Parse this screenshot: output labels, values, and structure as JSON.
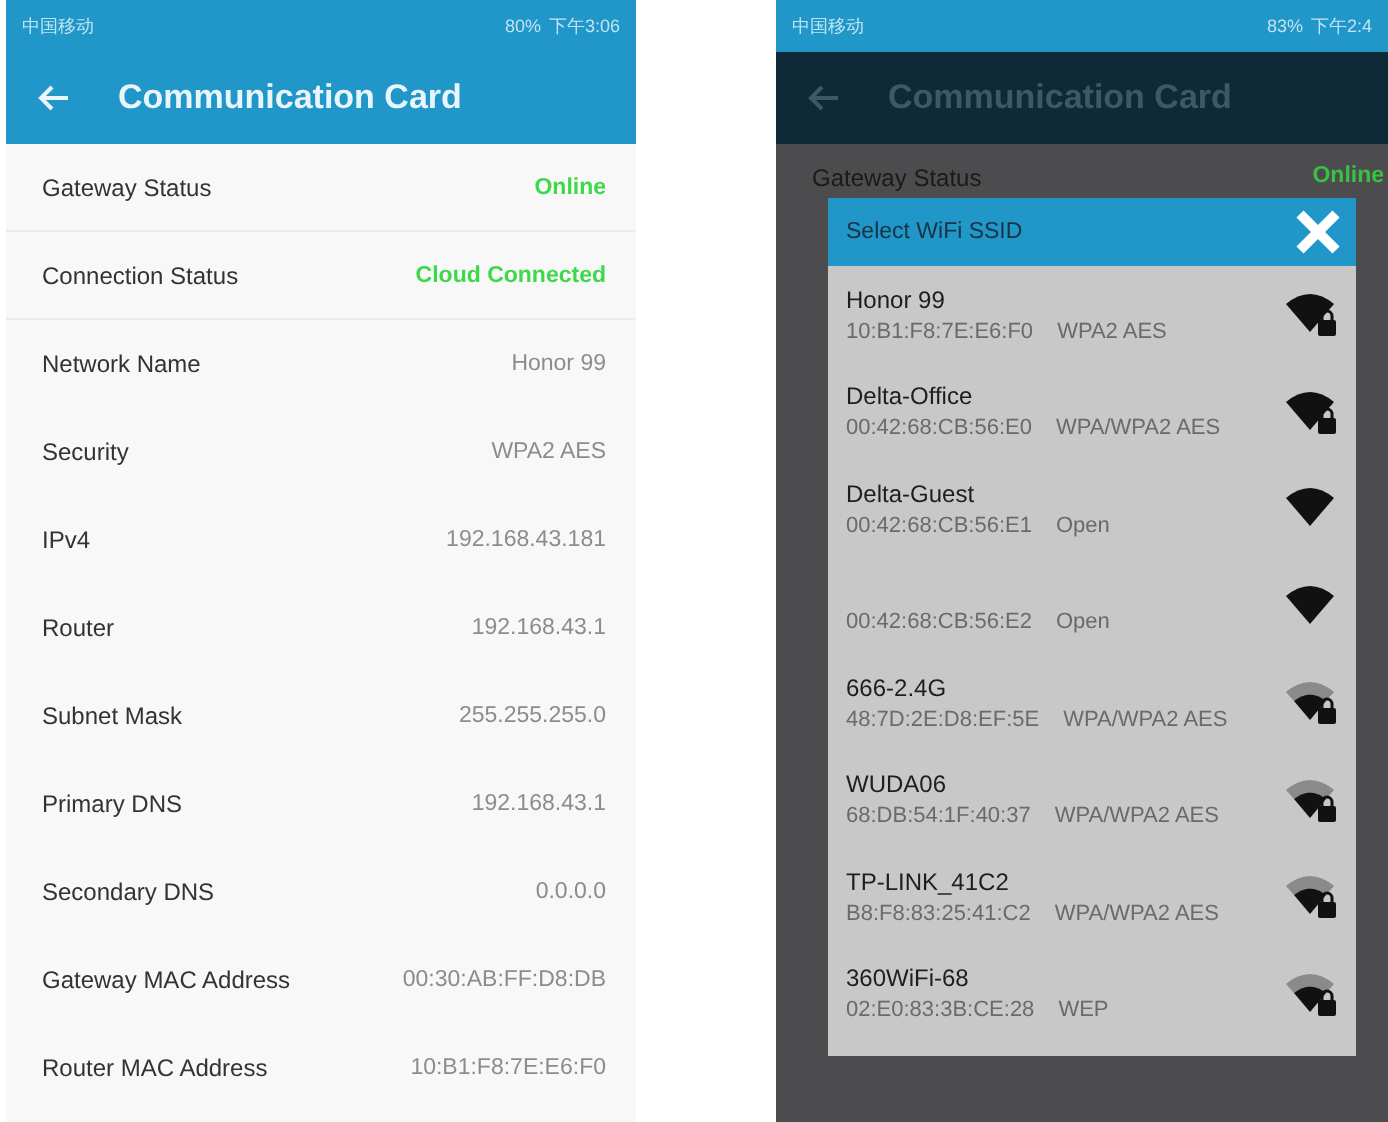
{
  "left_phone": {
    "status_bar": {
      "carrier": "中国移动",
      "battery": "80%",
      "time": "下午3:06"
    },
    "title_bar": {
      "title": "Communication Card"
    },
    "rows": [
      {
        "label": "Gateway Status",
        "value": "Online",
        "kind": "status"
      },
      {
        "label": "Connection Status",
        "value": "Cloud Connected",
        "kind": "status"
      },
      {
        "label": "Network Name",
        "value": "Honor 99",
        "kind": "plain"
      },
      {
        "label": "Security",
        "value": "WPA2 AES",
        "kind": "plain"
      },
      {
        "label": "IPv4",
        "value": "192.168.43.181",
        "kind": "plain"
      },
      {
        "label": "Router",
        "value": "192.168.43.1",
        "kind": "plain"
      },
      {
        "label": "Subnet Mask",
        "value": "255.255.255.0",
        "kind": "plain"
      },
      {
        "label": "Primary DNS",
        "value": "192.168.43.1",
        "kind": "plain"
      },
      {
        "label": "Secondary DNS",
        "value": "0.0.0.0",
        "kind": "plain"
      },
      {
        "label": "Gateway MAC Address",
        "value": "00:30:AB:FF:D8:DB",
        "kind": "plain"
      },
      {
        "label": "Router MAC Address",
        "value": "10:B1:F8:7E:E6:F0",
        "kind": "plain"
      }
    ]
  },
  "right_phone": {
    "status_bar": {
      "carrier": "中国移动",
      "battery": "83%",
      "time": "下午2:4"
    },
    "title_bar": {
      "title": "Communication Card"
    },
    "background_rows": [
      {
        "label": "Gateway Status",
        "value": "Online"
      }
    ],
    "dialog": {
      "title": "Select WiFi SSID",
      "networks": [
        {
          "name": "Honor 99",
          "mac": "10:B1:F8:7E:E6:F0",
          "security": "WPA2 AES",
          "kind": "full",
          "locked": true
        },
        {
          "name": "Delta-Office",
          "mac": "00:42:68:CB:56:E0",
          "security": "WPA/WPA2 AES",
          "kind": "full",
          "locked": true
        },
        {
          "name": "Delta-Guest",
          "mac": "00:42:68:CB:56:E1",
          "security": "Open",
          "kind": "full",
          "locked": false
        },
        {
          "mac": "00:42:68:CB:56:E2",
          "security": "Open",
          "kind": "full",
          "locked": false
        },
        {
          "name": "666-2.4G",
          "mac": "48:7D:2E:D8:EF:5E",
          "security": "WPA/WPA2 AES",
          "kind": "partial",
          "locked": true
        },
        {
          "name": "WUDA06",
          "mac": "68:DB:54:1F:40:37",
          "security": "WPA/WPA2 AES",
          "kind": "partial",
          "locked": true
        },
        {
          "name": "TP-LINK_41C2",
          "mac": "B8:F8:83:25:41:C2",
          "security": "WPA/WPA2 AES",
          "kind": "partial",
          "locked": true
        },
        {
          "name": "360WiFi-68",
          "mac": "02:E0:83:3B:CE:28",
          "security": "WEP",
          "kind": "partial",
          "locked": true
        }
      ]
    }
  }
}
